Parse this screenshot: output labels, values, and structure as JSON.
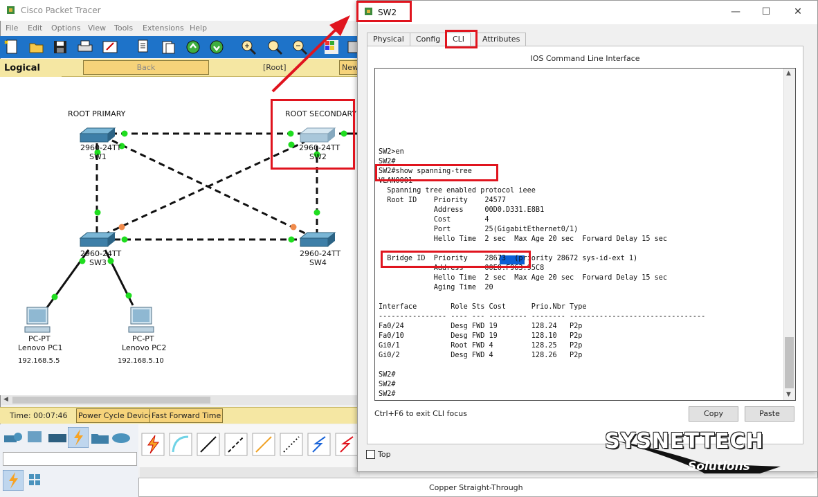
{
  "main_window": {
    "title": "Cisco Packet Tracer",
    "menu": [
      "File",
      "Edit",
      "Options",
      "View",
      "Tools",
      "Extensions",
      "Help"
    ],
    "logical_label": "Logical",
    "back_label": "Back",
    "root_label": "[Root]",
    "new_label": "New",
    "time_label": "Time: 00:07:46",
    "power_cycle_label": "Power Cycle Devices",
    "fast_forward_label": "Fast Forward Time",
    "status_text": "Copper Straight-Through"
  },
  "topology": {
    "labels": {
      "root_primary": "ROOT PRIMARY",
      "root_secondary": "ROOT SECONDARY"
    },
    "devices": [
      {
        "model": "2960-24TT",
        "name": "SW1"
      },
      {
        "model": "2960-24TT",
        "name": "SW2"
      },
      {
        "model": "2960-24TT",
        "name": "SW3"
      },
      {
        "model": "2960-24TT",
        "name": "SW4"
      }
    ],
    "pcs": [
      {
        "type": "PC-PT",
        "name": "Lenovo PC1",
        "ip": "192.168.5.5"
      },
      {
        "type": "PC-PT",
        "name": "Lenovo PC2",
        "ip": "192.168.5.10"
      }
    ],
    "colors": {
      "link_up": "#1fdd1f",
      "link_blocked": "#f08a4b",
      "switch": "#4b93bd"
    }
  },
  "dialog": {
    "title": "SW2",
    "tabs": [
      "Physical",
      "Config",
      "CLI",
      "Attributes"
    ],
    "active_tab": "CLI",
    "header": "IOS Command Line Interface",
    "cli_lines": [
      "SW2>en",
      "SW2#",
      "SW2#show spanning-tree",
      "VLAN0001",
      "  Spanning tree enabled protocol ieee",
      "  Root ID    Priority    24577",
      "             Address     00D0.D331.E8B1",
      "             Cost        4",
      "             Port        25(GigabitEthernet0/1)",
      "             Hello Time  2 sec  Max Age 20 sec  Forward Delay 15 sec",
      "",
      "  Bridge ID  Priority    28673  (priority 28672 sys-id-ext 1)",
      "             Address     00E0.F963.95C8",
      "             Hello Time  2 sec  Max Age 20 sec  Forward Delay 15 sec",
      "             Aging Time  20",
      "",
      "Interface        Role Sts Cost      Prio.Nbr Type",
      "---------------- ---- --- --------- -------- --------------------------------",
      "Fa0/24           Desg FWD 19        128.24   P2p",
      "Fa0/10           Desg FWD 19        128.10   P2p",
      "Gi0/1            Root FWD 4         128.25   P2p",
      "Gi0/2            Desg FWD 4         128.26   P2p",
      "",
      "SW2#",
      "SW2#",
      "SW2#"
    ],
    "highlighted_value": "28673",
    "hint": "Ctrl+F6 to exit CLI focus",
    "copy_label": "Copy",
    "paste_label": "Paste",
    "top_label": "Top"
  },
  "watermark": {
    "main": "SYSNETTECH",
    "sub": "Solutions"
  }
}
